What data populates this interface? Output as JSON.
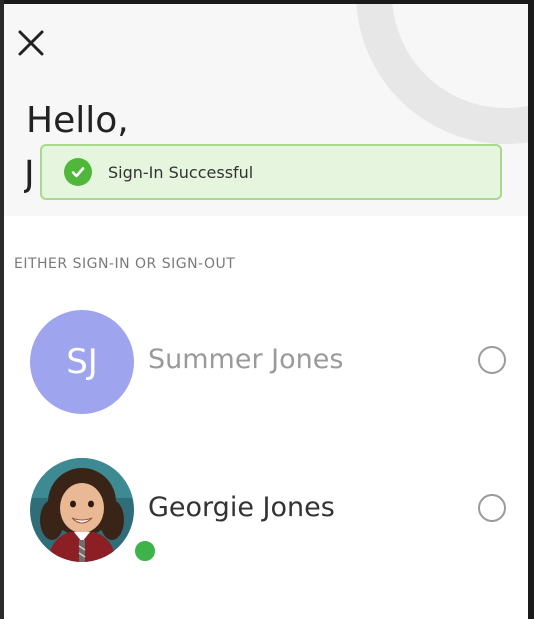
{
  "header": {
    "close_icon": "close-icon",
    "greeting": "Hello,",
    "greeting_name_partial": "J"
  },
  "toast": {
    "icon": "check-circle-icon",
    "message": "Sign-In Successful",
    "colors": {
      "background": "#e6f5de",
      "border": "#a9d98f",
      "icon": "#4fb83a"
    }
  },
  "section": {
    "label": "EITHER SIGN-IN OR SIGN-OUT"
  },
  "users": [
    {
      "initials": "SJ",
      "name": "Summer Jones",
      "avatar_color": "#9ea4ee",
      "selected": false,
      "online": false
    },
    {
      "name": "Georgie Jones",
      "avatar": "child-photo",
      "selected": false,
      "online": true,
      "status_color": "#3db34a"
    }
  ]
}
